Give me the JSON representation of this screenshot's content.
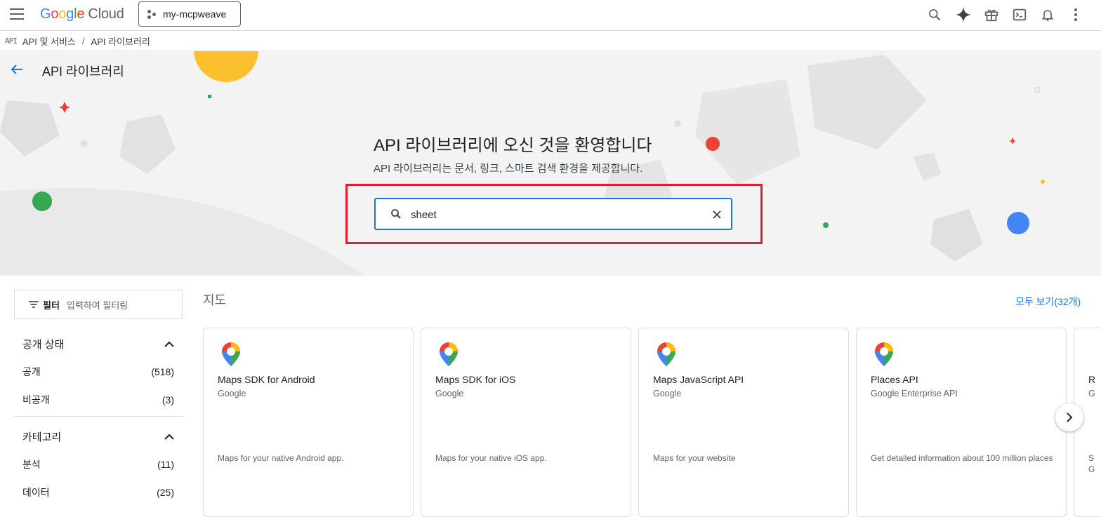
{
  "header": {
    "logo_google": "Google",
    "logo_cloud": "Cloud",
    "project_name": "my-mcpweave"
  },
  "breadcrumb": {
    "icon_text": "API",
    "items": [
      "API 및 서비스",
      "API 라이브러리"
    ]
  },
  "hero": {
    "page_title": "API 라이브러리",
    "title": "API 라이브러리에 오신 것을 환영합니다",
    "subtitle": "API 라이브러리는 문서, 링크, 스마트 검색 환경을 제공합니다.",
    "search_value": "sheet"
  },
  "filter": {
    "label": "필터",
    "placeholder": "입력하여 필터링"
  },
  "sidebar": {
    "sections": [
      {
        "title": "공개 상태",
        "items": [
          {
            "label": "공개",
            "count": "(518)"
          },
          {
            "label": "비공개",
            "count": "(3)"
          }
        ]
      },
      {
        "title": "카테고리",
        "items": [
          {
            "label": "분석",
            "count": "(11)"
          },
          {
            "label": "데이터",
            "count": "(25)"
          }
        ]
      }
    ]
  },
  "main": {
    "section_title": "지도",
    "view_all": "모두 보기(32개)",
    "cards": [
      {
        "title": "Maps SDK for Android",
        "org": "Google",
        "desc": "Maps for your native Android app."
      },
      {
        "title": "Maps SDK for iOS",
        "org": "Google",
        "desc": "Maps for your native iOS app."
      },
      {
        "title": "Maps JavaScript API",
        "org": "Google",
        "desc": "Maps for your website"
      },
      {
        "title": "Places API",
        "org": "Google Enterprise API",
        "desc": "Get detailed information about 100 million places"
      }
    ],
    "partial_card": {
      "title_char": "R",
      "org_char": "G",
      "desc_chars": [
        "S",
        "G"
      ]
    }
  },
  "colors": {
    "accent": "#1a73e8",
    "highlight": "#e01e2a"
  }
}
